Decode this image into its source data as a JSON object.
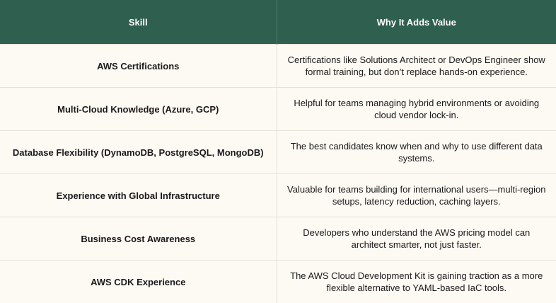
{
  "header": {
    "col_skill": "Skill",
    "col_value": "Why It Adds Value"
  },
  "rows": [
    {
      "skill": "AWS Certifications",
      "value": "Certifications like Solutions Architect or DevOps Engineer show formal training, but don’t replace hands-on experience."
    },
    {
      "skill": "Multi-Cloud Knowledge (Azure, GCP)",
      "value": "Helpful for teams managing hybrid environments or avoiding cloud vendor lock-in."
    },
    {
      "skill": "Database Flexibility (DynamoDB, PostgreSQL, MongoDB)",
      "value": "The best candidates know when and why to use different data systems."
    },
    {
      "skill": "Experience with Global Infrastructure",
      "value": "Valuable for teams building for international users—multi-region setups, latency reduction, caching layers."
    },
    {
      "skill": "Business Cost Awareness",
      "value": "Developers who understand the AWS pricing model can architect smarter, not just faster."
    },
    {
      "skill": "AWS CDK Experience",
      "value": "The AWS Cloud Development Kit is gaining traction as a more flexible alternative to YAML-based IaC tools."
    }
  ],
  "colors": {
    "header_bg": "#2f5f4e",
    "header_text": "#ffffff",
    "body_bg": "#fdf9f3",
    "divider": "#e6e1d8"
  }
}
